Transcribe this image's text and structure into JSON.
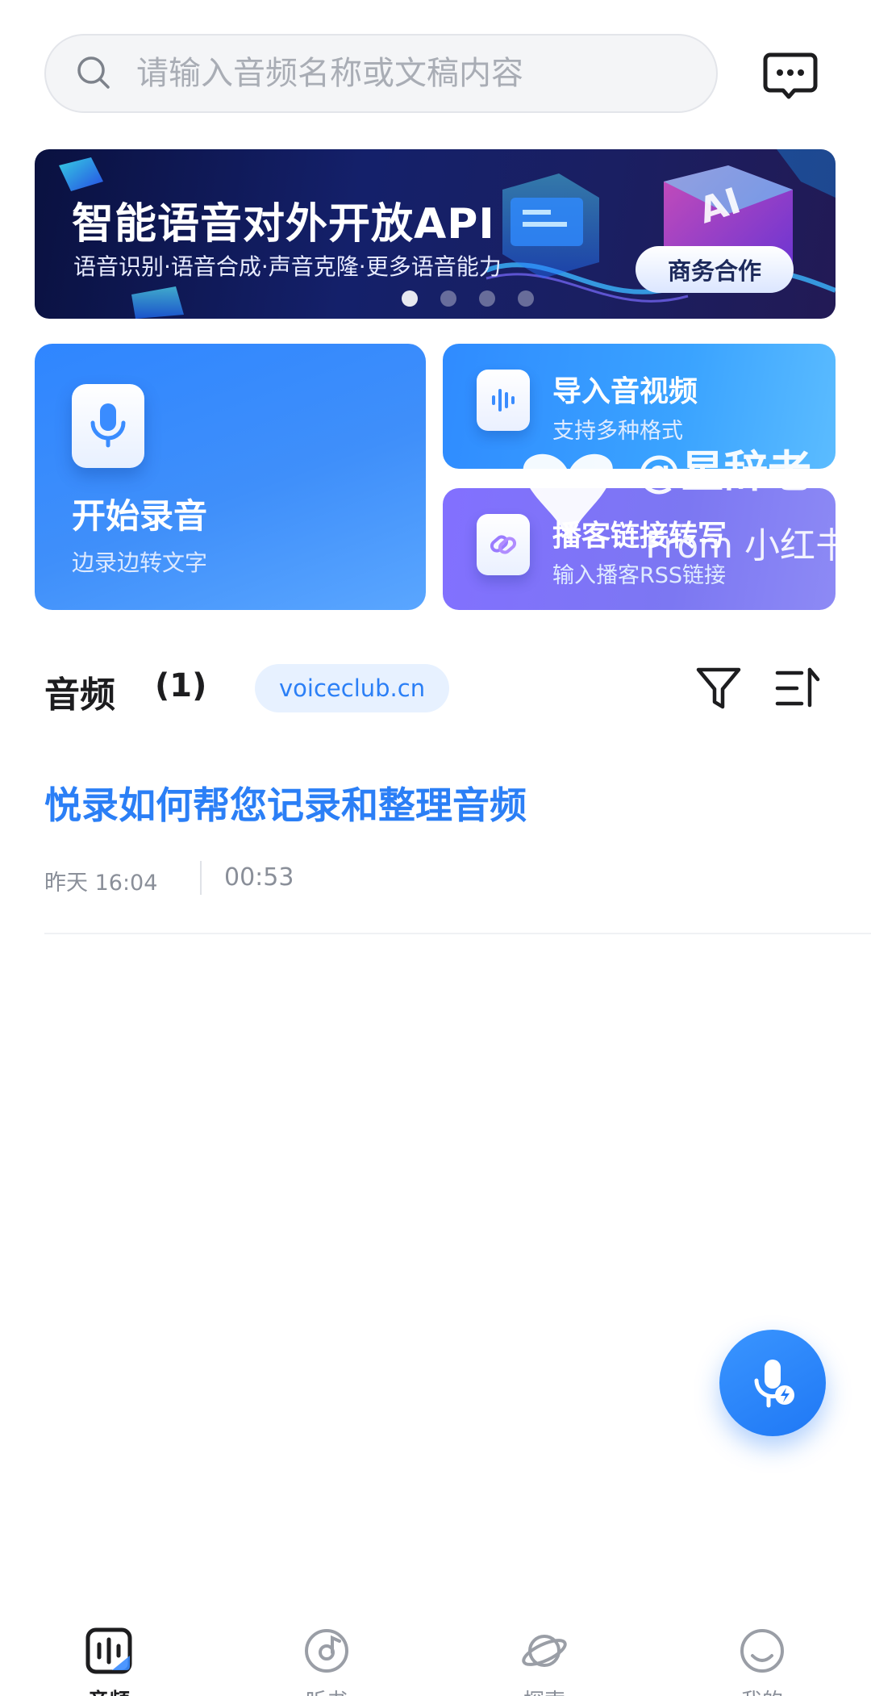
{
  "search": {
    "placeholder": "请输入音频名称或文稿内容"
  },
  "banner": {
    "title": "智能语音对外开放API",
    "subtitle": "语音识别·语音合成·声音克隆·更多语音能力",
    "button_label": "商务合作",
    "dots_count": 4,
    "active_dot": 0
  },
  "actions": {
    "record": {
      "title": "开始录音",
      "subtitle": "边录边转文字"
    },
    "import": {
      "title": "导入音视频",
      "subtitle": "支持多种格式"
    },
    "podcast": {
      "title": "播客链接转写",
      "subtitle": "输入播客RSS链接"
    }
  },
  "watermark": {
    "handle": "@星辞老",
    "from": "From 小红书"
  },
  "list": {
    "title": "音频",
    "count": "(1)",
    "tag": "voiceclub.cn",
    "items": [
      {
        "title": "悦录如何帮您记录和整理音频",
        "time": "昨天 16:04",
        "duration": "00:53"
      }
    ]
  },
  "tabbar": {
    "items": [
      {
        "label": "音频",
        "icon": "audio-wave-icon"
      },
      {
        "label": "听书",
        "icon": "music-disc-icon"
      },
      {
        "label": "探索",
        "icon": "planet-icon"
      },
      {
        "label": "我的",
        "icon": "profile-face-icon"
      }
    ],
    "active": 0
  },
  "colors": {
    "accent": "#2b7ff6",
    "record_card": "#3a8cff",
    "podcast_card": "#7f76f5",
    "banner_bg": "#0f1650"
  }
}
